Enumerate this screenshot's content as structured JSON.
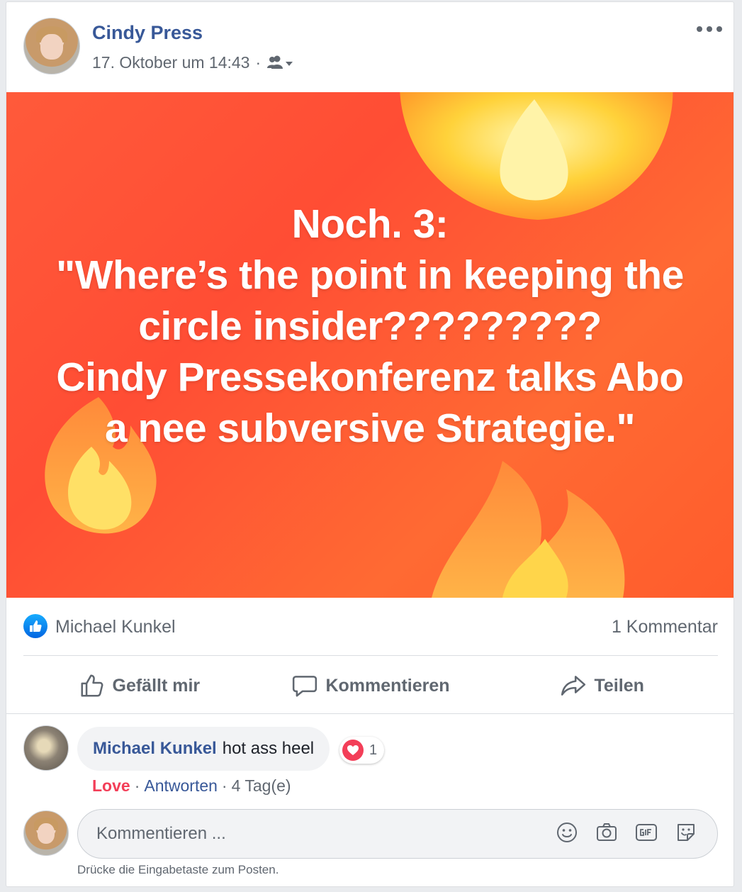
{
  "post": {
    "author_name": "Cindy Press",
    "timestamp": "17. Oktober um 14:43",
    "meta_separator": "·",
    "audience_icon": "friends-icon",
    "image_text": "Noch. 3:\n\"Where’s the point in keeping the circle insider?????????\nCindy Pressekonferenz talks Abo a nee subversive Strategie.\"",
    "image_bg": "#ff5236"
  },
  "reactions": {
    "reactor_name": "Michael Kunkel",
    "comment_count": "1 Kommentar"
  },
  "actions": {
    "like_label": "Gefällt mir",
    "comment_label": "Kommentieren",
    "share_label": "Teilen"
  },
  "comment": {
    "author": "Michael Kunkel",
    "text": "hot ass heel",
    "reaction_count": "1",
    "love_label": "Love",
    "sep1": "·",
    "reply_label": "Antworten",
    "sep2": "·",
    "time": "4 Tag(e)"
  },
  "composer": {
    "placeholder": "Kommentieren ...",
    "hint": "Drücke die Eingabetaste zum Posten."
  },
  "colors": {
    "link_blue": "#385898",
    "love_red": "#f33e58",
    "meta_gray": "#606770"
  }
}
